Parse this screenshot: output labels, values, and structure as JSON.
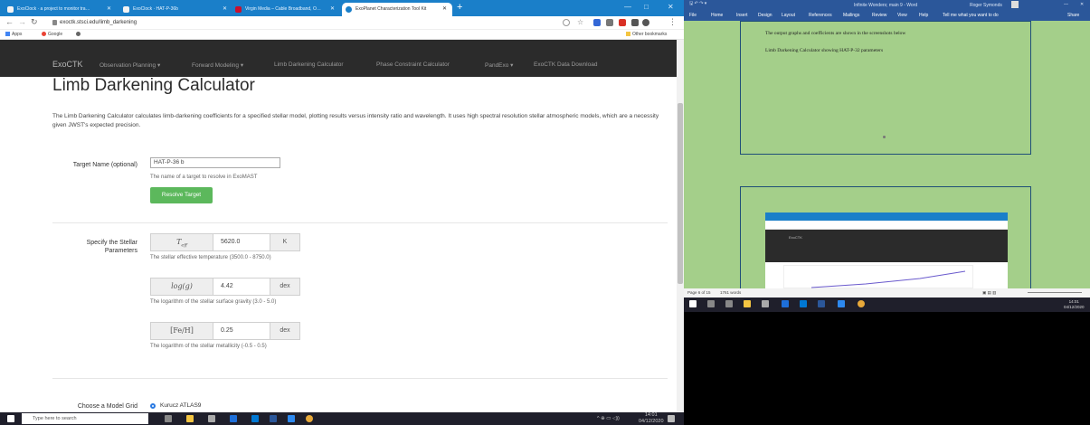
{
  "browser": {
    "tabs": [
      {
        "label": "ExoClock · a project to monitor tra…",
        "active": false
      },
      {
        "label": "ExoClock · HAT-P-36b",
        "active": false
      },
      {
        "label": "Virgin Media – Cable Broadband, O…",
        "active": false
      },
      {
        "label": "ExoPlanet Characterization Tool Kit",
        "active": true
      }
    ],
    "new_tab": "+",
    "window_controls": {
      "minimize": "—",
      "maximize": "□",
      "close": "✕"
    },
    "url": "exoctk.stsci.edu/limb_darkening",
    "bookmarks": {
      "apps": "Apps",
      "google": "Google",
      "other": "Other bookmarks"
    }
  },
  "site_nav": {
    "brand": "ExoCTK",
    "items": [
      "Observation Planning ▾",
      "Forward Modeling ▾",
      "Limb Darkening Calculator",
      "Phase Constraint Calculator",
      "PandExo ▾",
      "ExoCTK Data Download"
    ]
  },
  "page": {
    "title": "Limb Darkening Calculator",
    "intro": "The Limb Darkening Calculator calculates limb-darkening coefficients for a specified stellar model, plotting results versus intensity ratio and wavelength. It uses high spectral resolution stellar atmospheric models, which are a necessity given JWST's expected precision."
  },
  "form": {
    "target": {
      "label": "Target Name (optional)",
      "value": "HAT-P-36 b",
      "help": "The name of a target to resolve in ExoMAST",
      "button": "Resolve Target"
    },
    "stellar": {
      "label_line1": "Specify the Stellar",
      "label_line2": "Parameters",
      "teff": {
        "symbol": "Teff",
        "value": "5620.0",
        "unit": "K",
        "help": "The stellar effective temperature (3500.0 - 8750.0)"
      },
      "logg": {
        "symbol": "log(g)",
        "value": "4.42",
        "unit": "dex",
        "help": "The logarithm of the stellar surface gravity (3.0 - 5.0)"
      },
      "feh": {
        "symbol": "[Fe/H]",
        "value": "0.25",
        "unit": "dex",
        "help": "The logarithm of the stellar metallicity (-0.5 - 0.5)"
      }
    },
    "model_grid": {
      "label": "Choose a Model Grid",
      "option": "Kurucz ATLAS9",
      "selected": true
    }
  },
  "taskbar_left": {
    "search_placeholder": "Type here to search",
    "time": "14:01",
    "date": "04/12/2020"
  },
  "word": {
    "title": "Infinite Wonders; main 9 - Word",
    "user": "Roger Symonds",
    "ribbon": [
      "File",
      "Home",
      "Insert",
      "Design",
      "Layout",
      "References",
      "Mailings",
      "Review",
      "View",
      "Help"
    ],
    "tell_me": "Tell me what you want to do",
    "share": "Share",
    "doc_line1": "The output graphs and coefficients are shown in the screenshots below",
    "doc_line2": "Limb Darkening Calculator showing HAT-P-32 parameters",
    "status": {
      "page": "Page 6 of 15",
      "words": "1761 words"
    },
    "time": "14:01",
    "date": "04/12/2020",
    "screenshot_brand": "ExoCTK"
  },
  "colors": {
    "chrome_blue": "#1a7fc9",
    "navbar": "#2b2b2b",
    "button_green": "#5cb85c",
    "word_blue": "#2b579a",
    "desktop_green": "#a4cf8a"
  }
}
